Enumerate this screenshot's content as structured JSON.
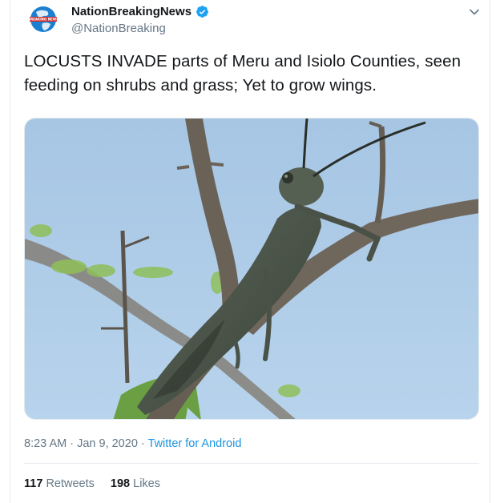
{
  "tweet": {
    "author": {
      "name": "NationBreakingNews",
      "handle": "@NationBreaking",
      "verified": true,
      "logo_text": "BREAKING NEWS"
    },
    "text": "LOCUSTS INVADE parts of Meru and Isiolo Counties, seen feeding on shrubs and grass; Yet to grow wings.",
    "media": {
      "icon": "locust-photo"
    },
    "meta": {
      "time": "8:23 AM",
      "date": "Jan 9, 2020",
      "source": "Twitter for Android"
    },
    "stats": {
      "retweets": "117",
      "retweets_label": "Retweets",
      "likes": "198",
      "likes_label": "Likes"
    }
  },
  "colors": {
    "accent": "#1da1f2",
    "sky": "#a9c9e6",
    "text": "#14171a",
    "muted": "#657786"
  }
}
